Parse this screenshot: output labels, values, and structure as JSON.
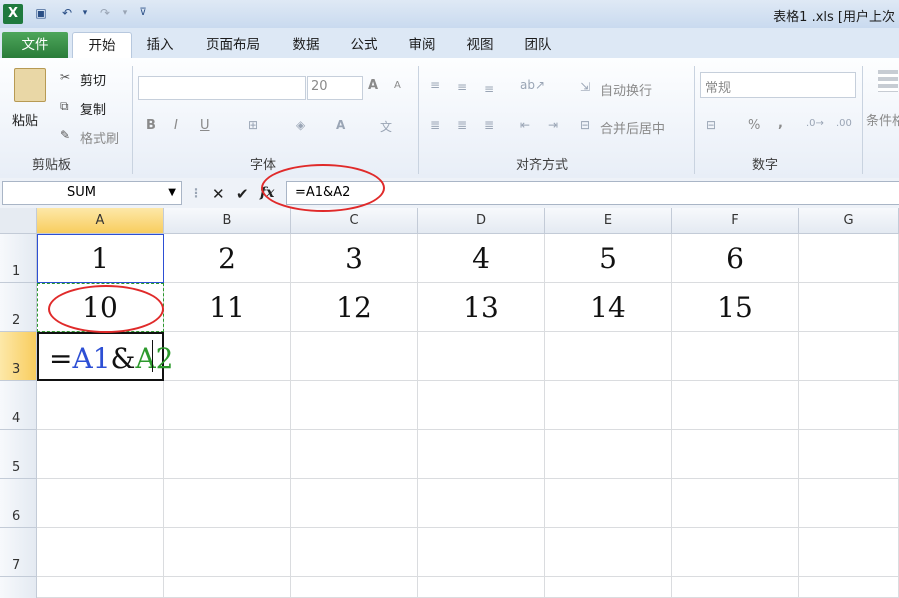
{
  "title_bar": {
    "title": "表格1 .xls [用户上次"
  },
  "tabs": [
    {
      "label": "文件"
    },
    {
      "label": "开始"
    },
    {
      "label": "插入"
    },
    {
      "label": "页面布局"
    },
    {
      "label": "数据"
    },
    {
      "label": "公式"
    },
    {
      "label": "审阅"
    },
    {
      "label": "视图"
    },
    {
      "label": "团队"
    }
  ],
  "ribbon": {
    "clipboard": {
      "paste": "粘贴",
      "cut": "剪切",
      "copy": "复制",
      "format_painter": "格式刷",
      "group": "剪贴板"
    },
    "font": {
      "size": "20",
      "bold": "B",
      "italic": "I",
      "underline": "U",
      "grow": "A",
      "shrink": "A",
      "group": "字体"
    },
    "alignment": {
      "wrap": "自动换行",
      "merge": "合并后居中",
      "group": "对齐方式"
    },
    "number": {
      "format": "常规",
      "percent": "%",
      "comma": ",",
      "group": "数字"
    },
    "styles": {
      "cond": "条件格"
    }
  },
  "formula_bar": {
    "name_box": "SUM",
    "fx": "fx",
    "formula": "=A1&A2"
  },
  "columns": [
    "A",
    "B",
    "C",
    "D",
    "E",
    "F",
    "G"
  ],
  "rows": [
    "1",
    "2",
    "3",
    "4",
    "5",
    "6",
    "7"
  ],
  "cells": {
    "r1": [
      "1",
      "2",
      "3",
      "4",
      "5",
      "6"
    ],
    "r2": [
      "10",
      "11",
      "12",
      "13",
      "14",
      "15"
    ],
    "a3": {
      "eq": "=",
      "ref1": "A1",
      "amp": "&",
      "ref2": "A2"
    }
  },
  "colors": {
    "accent": "#1f7a3e",
    "ref1": "#2d4fd4",
    "ref2": "#2d9a2d",
    "annotation": "#e02a2a"
  }
}
